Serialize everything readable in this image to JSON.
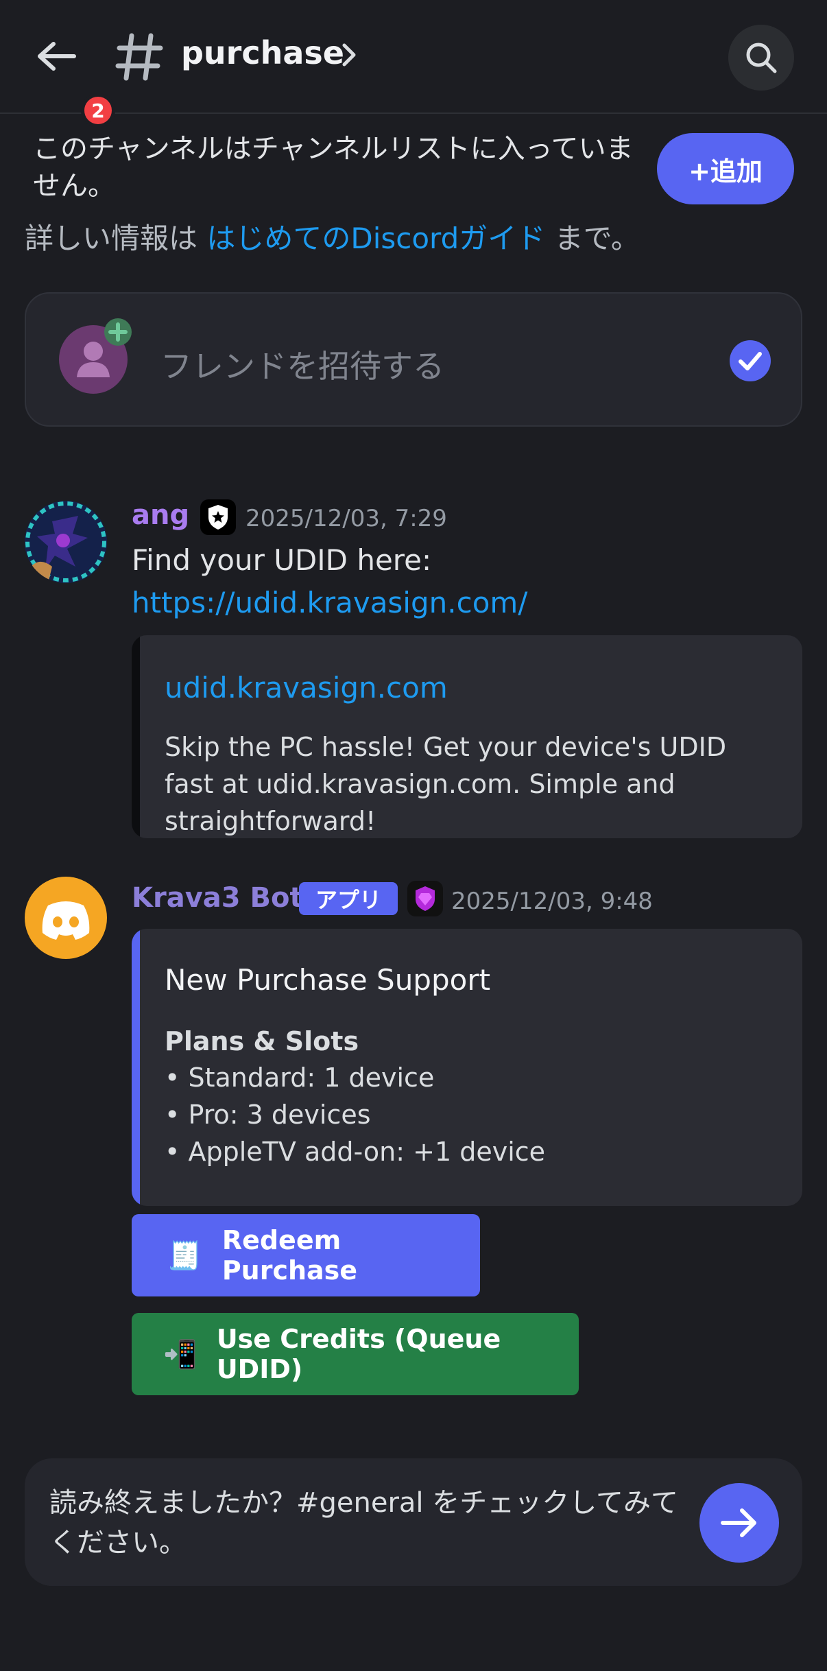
{
  "header": {
    "badge_count": "2",
    "channel_name": "purchase"
  },
  "notice": {
    "text": "このチャンネルはチャンネルリストに入っていません。",
    "add_button": "+追加",
    "info_prefix": "詳しい情報は ",
    "info_link": "はじめてのDiscordガイド",
    "info_suffix": " まで。"
  },
  "invite": {
    "label": "フレンドを招待する"
  },
  "messages": [
    {
      "author": "ang",
      "author_color": "#a97cf0",
      "timestamp": "2025/12/03, 7:29",
      "text_prefix": "Find your UDID here: ",
      "link": "https://udid.kravasign.com/",
      "embed": {
        "title": "udid.kravasign.com",
        "description": "Skip the PC hassle! Get your device's UDID fast at udid.kravasign.com. Simple and straightforward!"
      }
    },
    {
      "author": "Krava3 Bot",
      "author_color": "#8c7fd9",
      "app_tag": "アプリ",
      "timestamp": "2025/12/03, 9:48",
      "embed": {
        "title": "New Purchase Support",
        "subtitle": "Plans & Slots",
        "items": [
          "• Standard: 1 device",
          "• Pro: 3 devices",
          "• AppleTV add-on: +1 device"
        ]
      },
      "buttons": [
        {
          "emoji": "🧾",
          "label": "Redeem Purchase",
          "color": "#5865f2"
        },
        {
          "emoji": "📲",
          "label": "Use Credits (Queue UDID)",
          "color": "#248046"
        }
      ]
    }
  ],
  "composer": {
    "text": "読み終えましたか？#general をチェックしてみてください。"
  }
}
